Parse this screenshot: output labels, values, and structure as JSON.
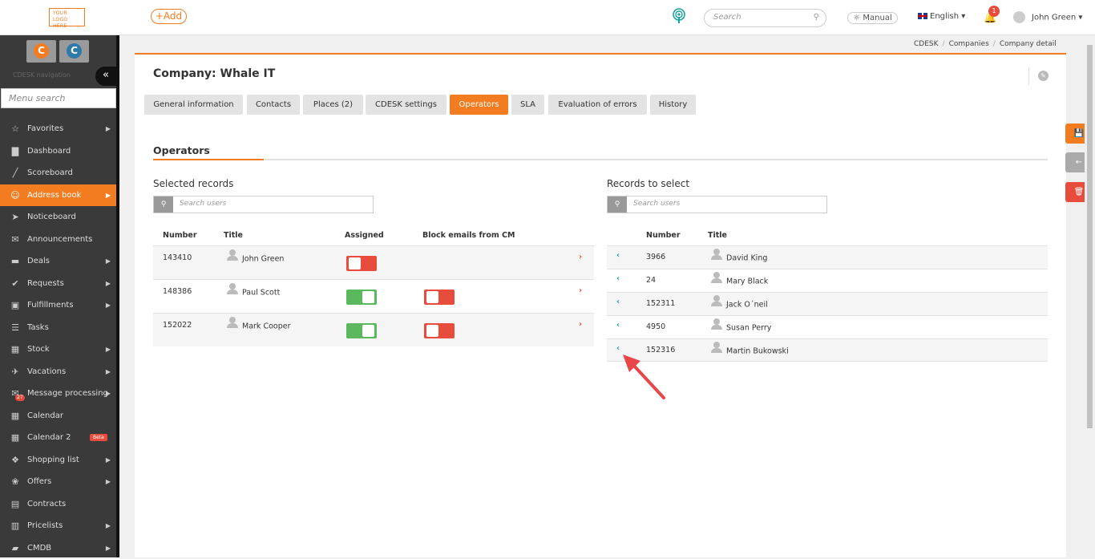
{
  "header": {
    "logo": "YOUR LOGO HERE",
    "add_label": "+Add",
    "search_placeholder": "Search",
    "manual_label": "Manual",
    "language": "English",
    "notification_count": "1",
    "user_name": "John Green"
  },
  "sidebar": {
    "nav_label": "CDESK navigation",
    "menu_search_placeholder": "Menu search",
    "items": [
      {
        "label": "Favorites",
        "icon": "star-icon",
        "arrow": true
      },
      {
        "label": "Dashboard",
        "icon": "bar-chart-icon",
        "arrow": false
      },
      {
        "label": "Scoreboard",
        "icon": "line-chart-icon",
        "arrow": false
      },
      {
        "label": "Address book",
        "icon": "user-icon",
        "arrow": true,
        "active": true
      },
      {
        "label": "Noticeboard",
        "icon": "paper-plane-icon",
        "arrow": false
      },
      {
        "label": "Announcements",
        "icon": "megaphone-icon",
        "arrow": false
      },
      {
        "label": "Deals",
        "icon": "card-icon",
        "arrow": true
      },
      {
        "label": "Requests",
        "icon": "check-circle-icon",
        "arrow": true
      },
      {
        "label": "Fulfillments",
        "icon": "box-icon",
        "arrow": true
      },
      {
        "label": "Tasks",
        "icon": "list-icon",
        "arrow": false
      },
      {
        "label": "Stock",
        "icon": "store-icon",
        "arrow": true
      },
      {
        "label": "Vacations",
        "icon": "plane-icon",
        "arrow": true
      },
      {
        "label": "Message processing",
        "icon": "mail-icon",
        "arrow": true,
        "badge": "27"
      },
      {
        "label": "Calendar",
        "icon": "calendar-icon",
        "arrow": false
      },
      {
        "label": "Calendar 2",
        "icon": "calendar-icon",
        "arrow": false,
        "beta": "Beta"
      },
      {
        "label": "Shopping list",
        "icon": "cart-icon",
        "arrow": true
      },
      {
        "label": "Offers",
        "icon": "gift-icon",
        "arrow": true
      },
      {
        "label": "Contracts",
        "icon": "document-icon",
        "arrow": false
      },
      {
        "label": "Pricelists",
        "icon": "calculator-icon",
        "arrow": true
      },
      {
        "label": "CMDB",
        "icon": "folder-icon",
        "arrow": true
      }
    ]
  },
  "breadcrumb": [
    "CDESK",
    "Companies",
    "Company detail"
  ],
  "page": {
    "title": "Company: Whale IT",
    "section_title": "Operators"
  },
  "tabs": [
    "General information",
    "Contacts",
    "Places (2)",
    "CDESK settings",
    "Operators",
    "SLA",
    "Evaluation of errors",
    "History"
  ],
  "selected": {
    "title": "Selected records",
    "search_placeholder": "Search users",
    "headers": [
      "Number",
      "Title",
      "Assigned",
      "Block emails from CM"
    ],
    "rows": [
      {
        "number": "143410",
        "name": "John Green",
        "assigned": "off",
        "block": null
      },
      {
        "number": "148386",
        "name": "Paul Scott",
        "assigned": "on",
        "block": "off"
      },
      {
        "number": "152022",
        "name": "Mark Cooper",
        "assigned": "on",
        "block": "off"
      }
    ]
  },
  "available": {
    "title": "Records to select",
    "search_placeholder": "Search users",
    "headers": [
      "Number",
      "Title"
    ],
    "rows": [
      {
        "number": "3966",
        "name": "David King"
      },
      {
        "number": "24",
        "name": "Mary Black"
      },
      {
        "number": "152311",
        "name": "Jack O´neil"
      },
      {
        "number": "4950",
        "name": "Susan Perry"
      },
      {
        "number": "152316",
        "name": "Martin Bukowski"
      }
    ]
  },
  "colors": {
    "accent": "#f47c20",
    "danger": "#e74c3c",
    "success": "#5cb85c",
    "teal": "#1aa1a1"
  }
}
